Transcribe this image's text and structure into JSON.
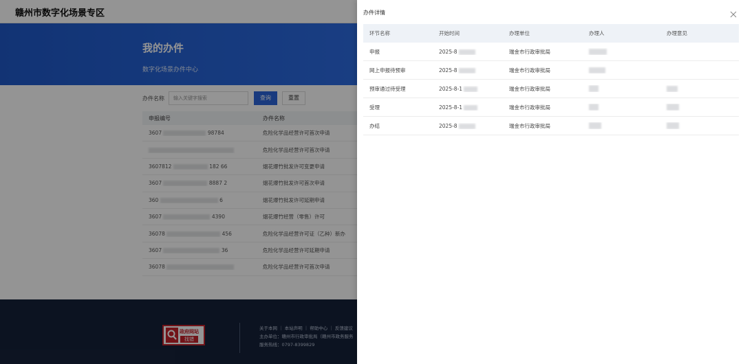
{
  "site": {
    "title": "赣州市数字化场景专区"
  },
  "banner": {
    "title": "我的办件",
    "subtitle": "数字化场景办件中心"
  },
  "search": {
    "label": "办件名称",
    "placeholder": "输入关键字搜索",
    "query_button": "查询",
    "reset_button": "重置"
  },
  "list": {
    "headers": [
      "申报编号",
      "办件名称"
    ],
    "rows": [
      {
        "number_prefix": "3607",
        "number_suffix": "98784",
        "name": "危险化学品经营许可首次申请"
      },
      {
        "number_prefix": "",
        "number_suffix": "",
        "name": "危险化学品经营许可首次申请"
      },
      {
        "number_prefix": "3607812",
        "number_suffix": "182 66",
        "name": "烟花爆竹批发许可变更申请"
      },
      {
        "number_prefix": "3607",
        "number_suffix": "8887 2",
        "name": "烟花爆竹批发许可首次申请"
      },
      {
        "number_prefix": "360",
        "number_suffix": "6",
        "name": "烟花爆竹批发许可延期申请"
      },
      {
        "number_prefix": "3607",
        "number_suffix": "4390",
        "name": "烟花爆竹经营（零售）许可"
      },
      {
        "number_prefix": "36078",
        "number_suffix": "456",
        "name": "危险化学品经营许可证（乙种）新办"
      },
      {
        "number_prefix": "3607",
        "number_suffix": "36",
        "name": "危险化学品经营许可延期申请"
      },
      {
        "number_prefix": "36078",
        "number_suffix": "",
        "name": "危险化学品经营许可首次申请"
      }
    ]
  },
  "footer": {
    "badge_top": "政府网站",
    "badge_bottom": "找错",
    "links": "关于本网 ｜ 本站声明 ｜ 帮助中心 ｜ 反馈建议",
    "sponsor": "主办单位：赣州市行政审批局（赣州市政务服务",
    "hotline": "服务热线：0797-8399829"
  },
  "drawer": {
    "title": "办件详情",
    "close_icon": "close-icon",
    "headers": [
      "环节名称",
      "开始时间",
      "办理单位",
      "办理人",
      "办理意见"
    ],
    "rows": [
      {
        "step": "申报",
        "start_time": "2025-8",
        "unit": "瑞金市行政审批局",
        "handler": "",
        "opinion": ""
      },
      {
        "step": "网上申报待预审",
        "start_time": "2025-8",
        "unit": "瑞金市行政审批局",
        "handler": "",
        "opinion": ""
      },
      {
        "step": "预审通过待受理",
        "start_time": "2025-8-1",
        "unit": "瑞金市行政审批局",
        "handler": "",
        "opinion": ""
      },
      {
        "step": "受理",
        "start_time": "2025-8-1",
        "unit": "瑞金市行政审批局",
        "handler": "",
        "opinion": ""
      },
      {
        "step": "办结",
        "start_time": "2025-8",
        "unit": "瑞金市行政审批局",
        "handler": "",
        "opinion": ""
      }
    ]
  },
  "colors": {
    "brand_blue": "#2b65d9",
    "footer_bg": "#16223a",
    "badge_red": "#c5222a"
  }
}
